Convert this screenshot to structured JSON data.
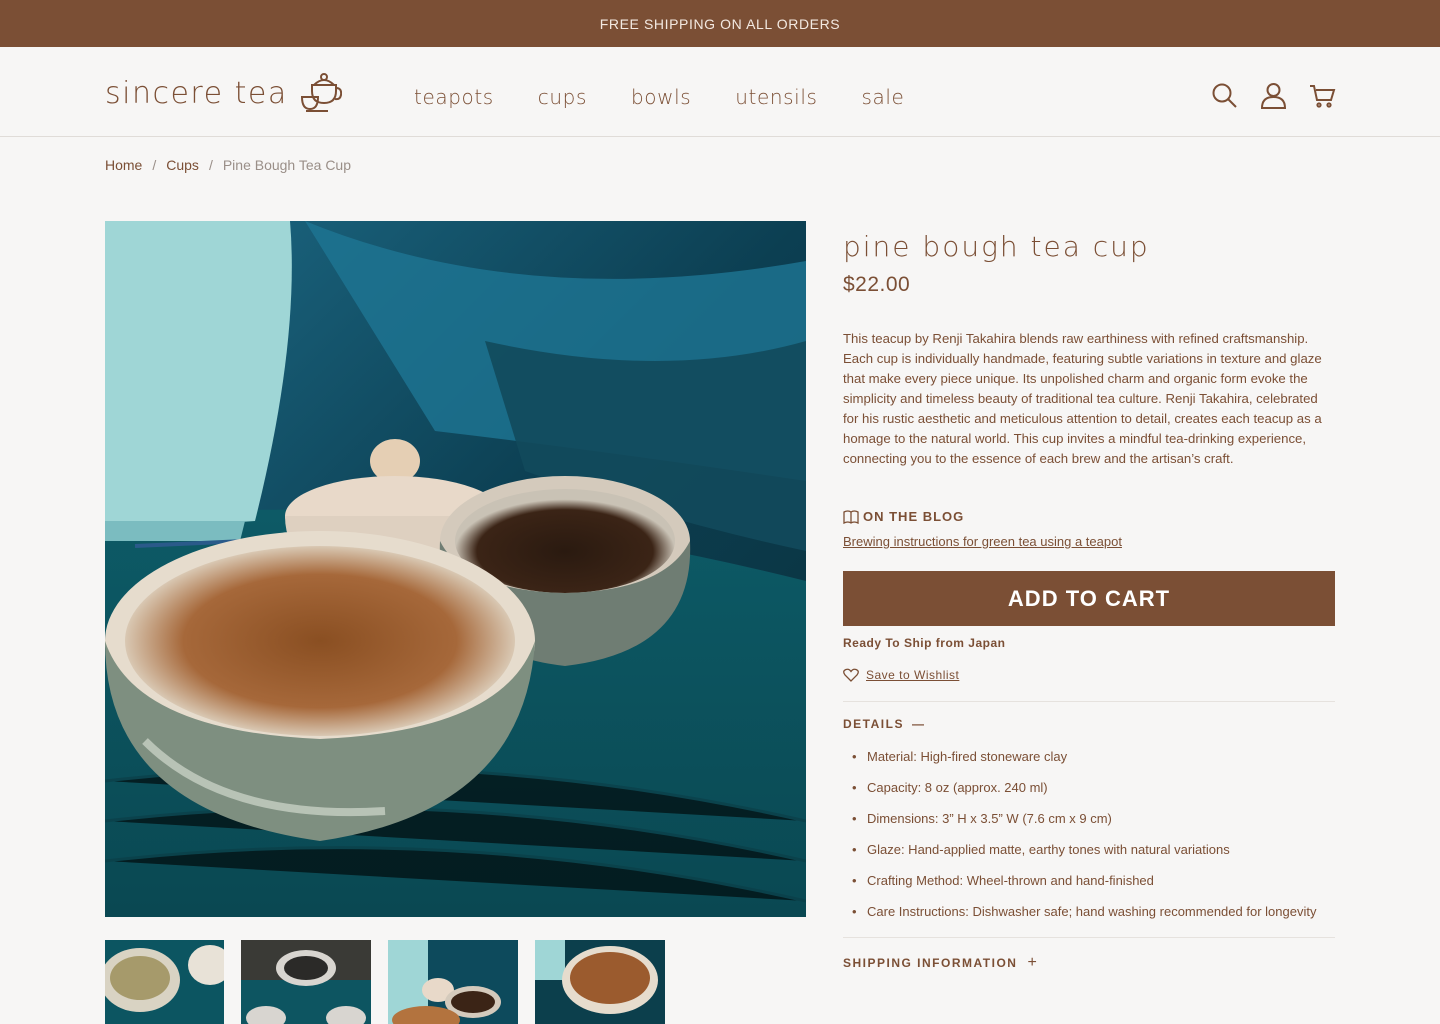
{
  "topbar": {
    "text": "FREE SHIPPING ON ALL ORDERS"
  },
  "header": {
    "logo_text": "sincere tea",
    "nav": [
      {
        "label": "teapots"
      },
      {
        "label": "cups"
      },
      {
        "label": "bowls"
      },
      {
        "label": "utensils"
      },
      {
        "label": "sale"
      }
    ],
    "icons": [
      "search-icon",
      "account-icon",
      "cart-icon"
    ]
  },
  "breadcrumb": {
    "home": "Home",
    "sep": "/",
    "category": "Cups",
    "current": "Pine Bough Tea Cup"
  },
  "product": {
    "title": "pine bough tea cup",
    "price": "$22.00",
    "description": "This teacup by Renji Takahira blends raw earthiness with refined craftsmanship. Each cup is individually handmade, featuring subtle variations in texture and glaze that make every piece unique. Its unpolished charm and organic form evoke the simplicity and timeless beauty of traditional tea culture. Renji Takahira, celebrated for his rustic aesthetic and meticulous attention to detail, creates each teacup as a homage to the natural world. This cup invites a mindful tea-drinking experience, connecting you to the essence of each brew and the artisan’s craft.",
    "blog_heading": "ON THE BLOG",
    "blog_link": "Brewing instructions for green tea using a teapot",
    "add_to_cart": "ADD TO CART",
    "ship_note": "Ready To Ship from Japan",
    "wishlist": "Save to Wishlist",
    "details_heading": "DETAILS",
    "details_toggle": "—",
    "details": [
      "Material: High-fired stoneware clay",
      "Capacity: 8 oz (approx. 240 ml)",
      "Dimensions: 3” H x 3.5” W (7.6 cm x 9 cm)",
      "Glaze: Hand-applied matte, earthy tones with natural variations",
      "Crafting Method: Wheel-thrown and hand-finished",
      "Care Instructions: Dishwasher safe; hand washing recommended for longevity"
    ],
    "shipping_heading": "SHIPPING INFORMATION",
    "shipping_toggle": "+"
  },
  "colors": {
    "brand": "#7b4f35",
    "background": "#f7f6f5",
    "teal": "#0b3f4b"
  }
}
